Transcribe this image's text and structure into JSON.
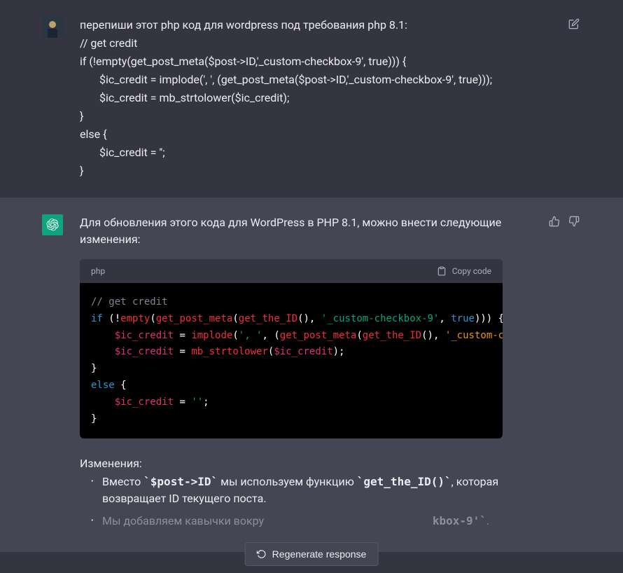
{
  "user_message": {
    "line1": "перепиши этот php код для wordpress под требования php 8.1:",
    "line2": "// get credit",
    "line3": "if (!empty(get_post_meta($post->ID,'_custom-checkbox-9', true))) {",
    "line4": "$ic_credit = implode(', ', (get_post_meta($post->ID,'_custom-checkbox-9', true)));",
    "line5": "$ic_credit = mb_strtolower($ic_credit);",
    "line6": "}",
    "line7": "else {",
    "line8": "$ic_credit = '';",
    "line9": "}"
  },
  "assistant_intro": "Для обновления этого кода для WordPress в PHP 8.1, можно внести следующие изменения:",
  "code": {
    "lang": "php",
    "copy_label": "Copy code",
    "comment": "// get credit",
    "kw_if": "if",
    "fn_empty": "empty",
    "fn_get_post_meta": "get_post_meta",
    "fn_get_the_id": "get_the_ID",
    "str_checkbox": "'_custom-checkbox-9'",
    "kw_true": "true",
    "var_ic_credit": "$ic_credit",
    "fn_implode": "implode",
    "str_sep": "', '",
    "fn_strtolower": "mb_strtolower",
    "kw_else": "else",
    "str_empty": "''",
    "tail_t": "t"
  },
  "changes": {
    "title": "Изменения:",
    "item1_pre": "Вместо ",
    "item1_code1": "`$post->ID`",
    "item1_mid": " мы используем функцию ",
    "item1_code2": "`get_the_ID()`",
    "item1_post": ", которая возвращает ID текущего поста.",
    "item2_pre": "Мы добавляем кавычки вокру",
    "item2_code": "kbox-9'`",
    "item2_post": "."
  },
  "regen_label": "Regenerate response"
}
